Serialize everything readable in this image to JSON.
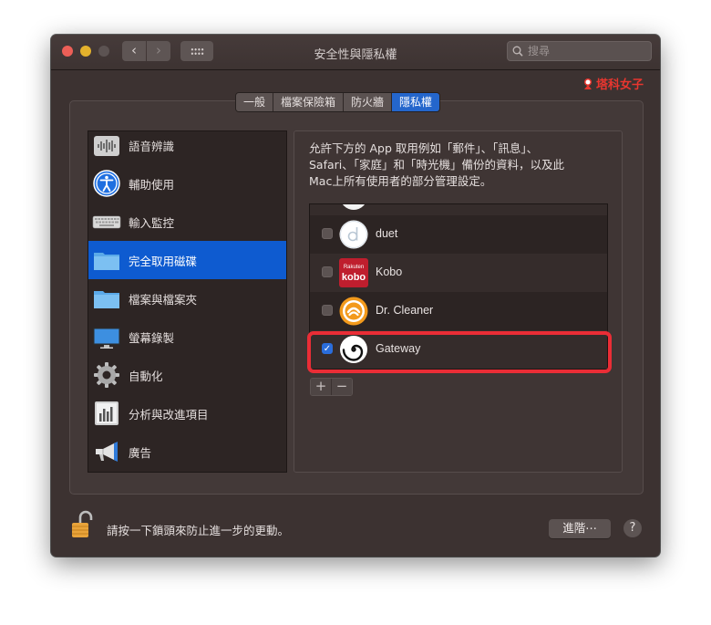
{
  "window": {
    "title": "安全性與隱私權"
  },
  "search": {
    "placeholder": "搜尋"
  },
  "watermark": {
    "text": "塔科女子"
  },
  "tabs": [
    {
      "label": "一般",
      "active": false
    },
    {
      "label": "檔案保險箱",
      "active": false
    },
    {
      "label": "防火牆",
      "active": false
    },
    {
      "label": "隱私權",
      "active": true
    }
  ],
  "sidebar": {
    "items": [
      {
        "label": "語音辨識",
        "icon": "speech-waveform-icon",
        "selected": false
      },
      {
        "label": "輔助使用",
        "icon": "accessibility-icon",
        "selected": false
      },
      {
        "label": "輸入監控",
        "icon": "keyboard-icon",
        "selected": false
      },
      {
        "label": "完全取用磁碟",
        "icon": "folder-icon",
        "selected": true
      },
      {
        "label": "檔案與檔案夾",
        "icon": "folder-icon",
        "selected": false
      },
      {
        "label": "螢幕錄製",
        "icon": "display-icon",
        "selected": false
      },
      {
        "label": "自動化",
        "icon": "gear-icon",
        "selected": false
      },
      {
        "label": "分析與改進項目",
        "icon": "bar-chart-icon",
        "selected": false
      },
      {
        "label": "廣告",
        "icon": "megaphone-icon",
        "selected": false
      }
    ]
  },
  "main": {
    "description_lines": [
      "允許下方的 App 取用例如「郵件」、「訊息」、",
      "Safari、「家庭」和「時光機」備份的資料，以及此",
      "Mac上所有使用者的部分管理設定。"
    ],
    "apps": [
      {
        "name": "duet",
        "checked": false,
        "icon": "duet-icon"
      },
      {
        "name": "Kobo",
        "checked": false,
        "icon": "kobo-icon",
        "icon_text_top": "Rakuten",
        "icon_text_bottom": "kobo"
      },
      {
        "name": "Dr. Cleaner",
        "checked": false,
        "icon": "dr-cleaner-icon"
      },
      {
        "name": "Gateway",
        "checked": true,
        "icon": "gateway-icon"
      }
    ],
    "add_label": "+",
    "remove_label": "−"
  },
  "footer": {
    "lock_text": "請按一下鎖頭來防止進一步的更動。",
    "advanced_label": "進階⋯",
    "help_label": "?"
  },
  "colors": {
    "accent": "#0e5bd0",
    "highlight": "#ea2d36",
    "window_bg": "#3c3231",
    "watermark": "#e8362f"
  }
}
